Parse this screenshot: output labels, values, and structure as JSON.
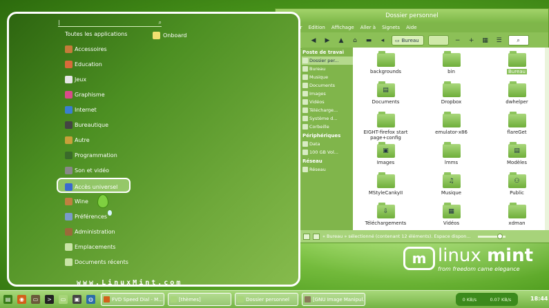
{
  "file_manager": {
    "title": "Dossier personnel",
    "menu": [
      "hier",
      "Edition",
      "Affichage",
      "Aller à",
      "Signets",
      "Aide"
    ],
    "path_button": "Bureau",
    "sidebar": {
      "sections": [
        {
          "heading": "Poste de travai",
          "items": [
            "Dossier per...",
            "Bureau",
            "Musique",
            "Documents",
            "Images",
            "Vidéos",
            "Télécharge...",
            "Système d...",
            "Corbeille"
          ]
        },
        {
          "heading": "Périphériques",
          "items": [
            "Data",
            "100 GB Vol..."
          ]
        },
        {
          "heading": "Réseau",
          "items": [
            "Réseau"
          ]
        }
      ]
    },
    "items": [
      {
        "name": "backgrounds",
        "emblem": ""
      },
      {
        "name": "bin",
        "emblem": ""
      },
      {
        "name": "Bureau",
        "emblem": ""
      },
      {
        "name": "Documents",
        "emblem": "▤"
      },
      {
        "name": "Dropbox",
        "emblem": ""
      },
      {
        "name": "dwhelper",
        "emblem": ""
      },
      {
        "name": "EIGHT-firefox start page+config",
        "emblem": ""
      },
      {
        "name": "emulator-x86",
        "emblem": ""
      },
      {
        "name": "flareGet",
        "emblem": ""
      },
      {
        "name": "Images",
        "emblem": "▣"
      },
      {
        "name": "lmms",
        "emblem": ""
      },
      {
        "name": "Modèles",
        "emblem": "▤"
      },
      {
        "name": "MStyleCankyII",
        "emblem": ""
      },
      {
        "name": "Musique",
        "emblem": "♫"
      },
      {
        "name": "Public",
        "emblem": "⚇"
      },
      {
        "name": "Téléchargements",
        "emblem": "⇩"
      },
      {
        "name": "Vidéos",
        "emblem": "▦"
      },
      {
        "name": "xdman",
        "emblem": ""
      }
    ],
    "status": "« Bureau » sélectionné (contenant 12 éléments). Espace dispon..."
  },
  "menu": {
    "search_text": "|",
    "all_apps": "Toutes les applications",
    "favorite": "Onboard",
    "categories": [
      "Accessoires",
      "Education",
      "Jeux",
      "Graphisme",
      "Internet",
      "Bureautique",
      "Autre",
      "Programmation",
      "Son et vidéo",
      "Accès universel",
      "Wine",
      "Préférences",
      "Administration",
      "Emplacements",
      "Documents récents"
    ],
    "url": "www.LinuxMint.com"
  },
  "logo": {
    "name_a": "linux",
    "name_b": "mint",
    "tagline": "from freedom came elegance"
  },
  "taskbar": {
    "windows": [
      "FVD Speed Dial - M...",
      "[thèmes]",
      "Dossier personnel",
      "[GNU Image Manipul..."
    ],
    "net_down": "0 KB/s",
    "net_up": "0.07 KB/s",
    "clock": "18:44"
  },
  "colors": {
    "accent": "#88c057",
    "dark_green": "#2d6510",
    "panel": "#a7d37a"
  }
}
